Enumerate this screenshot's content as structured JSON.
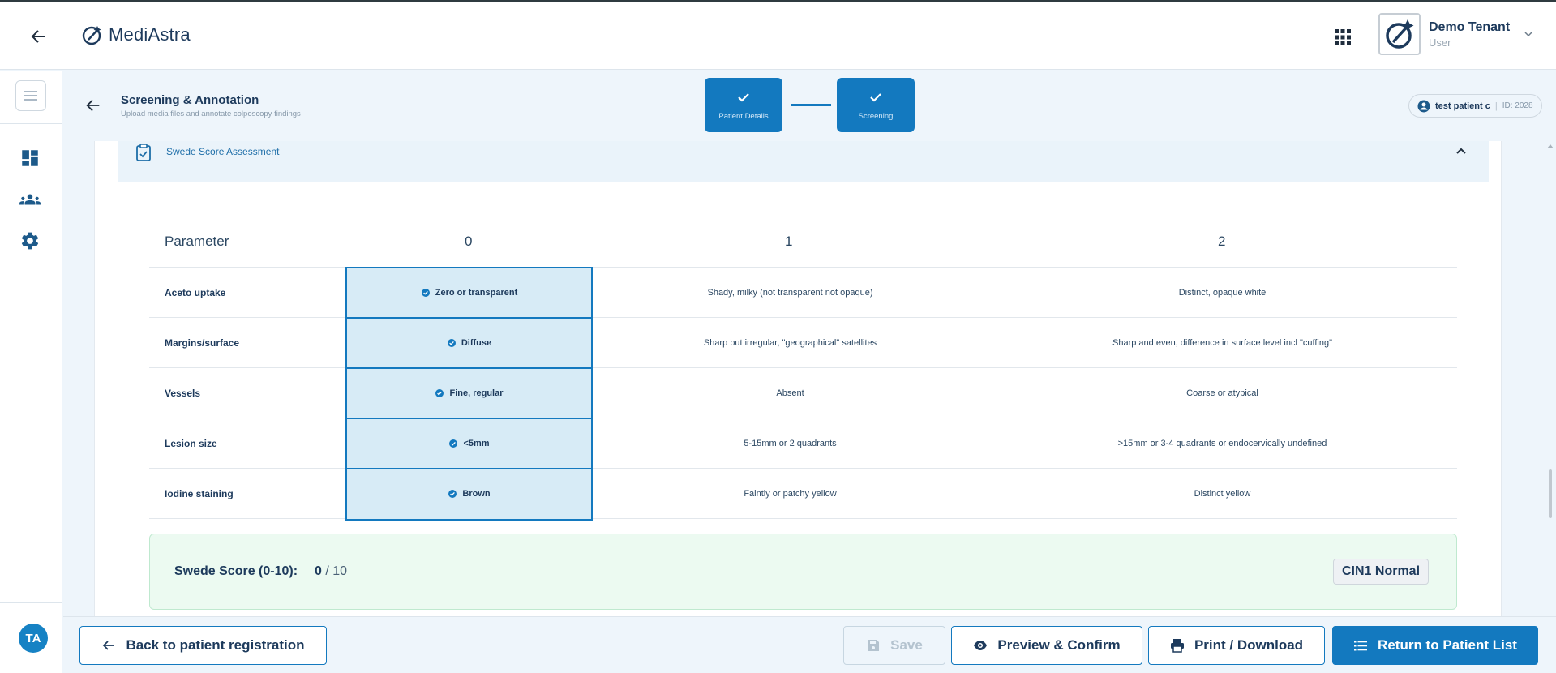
{
  "app": {
    "brand_name": "MediAstra"
  },
  "user": {
    "name": "Demo Tenant",
    "role": "User",
    "avatar_initials": "TA"
  },
  "page": {
    "title": "Screening & Annotation",
    "subtitle": "Upload media files and annotate colposcopy findings"
  },
  "steps": [
    {
      "label": "Patient Details",
      "status": "completed"
    },
    {
      "label": "Screening",
      "status": "completed"
    }
  ],
  "patient": {
    "name": "test patient c",
    "id_text": "ID: 2028"
  },
  "section": {
    "title": "Swede Score Assessment",
    "expanded": true
  },
  "table": {
    "headers": [
      "Parameter",
      "0",
      "1",
      "2"
    ],
    "rows": [
      {
        "param": "Aceto uptake",
        "options": [
          "Zero or transparent",
          "Shady, milky (not transparent not opaque)",
          "Distinct, opaque white"
        ],
        "selected": 0
      },
      {
        "param": "Margins/surface",
        "options": [
          "Diffuse",
          "Sharp but irregular, \"geographical\" satellites",
          "Sharp and even, difference in surface level incl \"cuffing\""
        ],
        "selected": 0
      },
      {
        "param": "Vessels",
        "options": [
          "Fine, regular",
          "Absent",
          "Coarse or atypical"
        ],
        "selected": 0
      },
      {
        "param": "Lesion size",
        "options": [
          "<5mm",
          "5-15mm or 2 quadrants",
          ">15mm or 3-4 quadrants or endocervically undefined"
        ],
        "selected": 0
      },
      {
        "param": "Iodine staining",
        "options": [
          "Brown",
          "Faintly or patchy yellow",
          "Distinct yellow"
        ],
        "selected": 0
      }
    ]
  },
  "score": {
    "label": "Swede Score (0-10):",
    "value": "0",
    "max_text": "/ 10",
    "badge": "CIN1 Normal"
  },
  "footer": {
    "back_label": "Back to patient registration",
    "save_label": "Save",
    "preview_label": "Preview & Confirm",
    "print_label": "Print / Download",
    "return_label": "Return to Patient List"
  },
  "colors": {
    "primary": "#1379bf",
    "selected_cell": "#d7ebf6",
    "score_bg": "#ecfaf1",
    "dark_text": "#1d3a5c"
  },
  "icons": [
    "back-arrow-icon",
    "brand-logo-icon",
    "apps-grid-icon",
    "chevron-down-icon",
    "hamburger-menu-icon",
    "dashboard-icon",
    "users-icon",
    "settings-gear-icon",
    "check-icon",
    "patient-avatar-icon",
    "clipboard-check-icon",
    "chevron-up-icon",
    "check-circle-icon",
    "floppy-disk-icon",
    "eye-icon",
    "printer-icon",
    "list-icon"
  ]
}
